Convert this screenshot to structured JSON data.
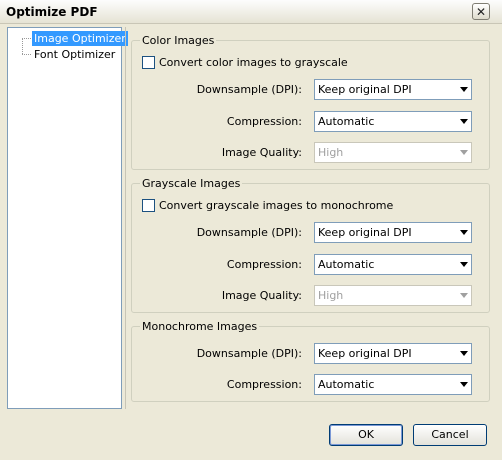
{
  "window": {
    "title": "Optimize PDF",
    "close_glyph": "✕"
  },
  "tree": {
    "items": [
      "Image Optimizer",
      "Font Optimizer"
    ],
    "selected": "Image Optimizer"
  },
  "color_images": {
    "title": "Color Images",
    "checkbox_label": "Convert color images to grayscale",
    "downsample_label": "Downsample (DPI):",
    "downsample_value": "Keep original DPI",
    "compression_label": "Compression:",
    "compression_value": "Automatic",
    "quality_label": "Image Quality:",
    "quality_value": "High"
  },
  "grayscale_images": {
    "title": "Grayscale Images",
    "checkbox_label": "Convert grayscale images to monochrome",
    "downsample_label": "Downsample (DPI):",
    "downsample_value": "Keep original DPI",
    "compression_label": "Compression:",
    "compression_value": "Automatic",
    "quality_label": "Image Quality:",
    "quality_value": "High"
  },
  "monochrome_images": {
    "title": "Monochrome Images",
    "downsample_label": "Downsample (DPI):",
    "downsample_value": "Keep original DPI",
    "compression_label": "Compression:",
    "compression_value": "Automatic"
  },
  "buttons": {
    "ok": "OK",
    "cancel": "Cancel"
  }
}
